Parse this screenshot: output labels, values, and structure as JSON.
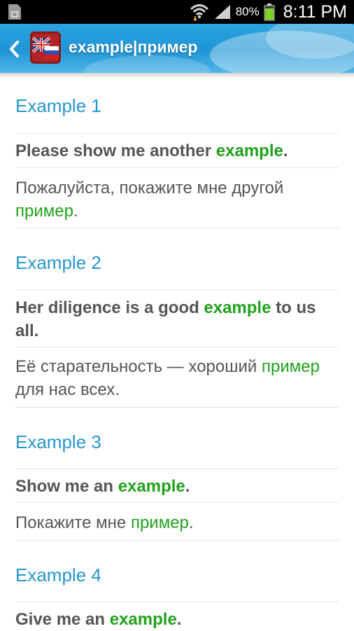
{
  "status_bar": {
    "battery_percent": "80%",
    "time": "8:11 PM"
  },
  "action_bar": {
    "title": "example|пример"
  },
  "examples": [
    {
      "header": "Example 1",
      "en_before": "Please show me another ",
      "en_highlight": "example",
      "en_after": ".",
      "ru_before": "Пожалуйста, покажите мне другой ",
      "ru_highlight": "пример",
      "ru_after": "."
    },
    {
      "header": "Example 2",
      "en_before": "Her diligence is a good ",
      "en_highlight": "example",
      "en_after": " to us all.",
      "ru_before": "Её старательность — хороший ",
      "ru_highlight": "пример",
      "ru_after": " для нас всех."
    },
    {
      "header": "Example 3",
      "en_before": "Show me an ",
      "en_highlight": "example",
      "en_after": ".",
      "ru_before": "Покажите мне ",
      "ru_highlight": "пример",
      "ru_after": "."
    },
    {
      "header": "Example 4",
      "en_before": "Give me an ",
      "en_highlight": "example",
      "en_after": "."
    }
  ],
  "colors": {
    "header_blue": "#2596cf",
    "highlight_green": "#21a11b",
    "text_gray": "#555555",
    "action_bar_blue": "#1f95d6"
  },
  "icons": {
    "status_left": "sim-card-icon",
    "wifi": "wifi-icon",
    "signal": "signal-icon",
    "battery": "battery-icon",
    "back": "chevron-left-icon",
    "app": "dictionary-flags-icon"
  }
}
